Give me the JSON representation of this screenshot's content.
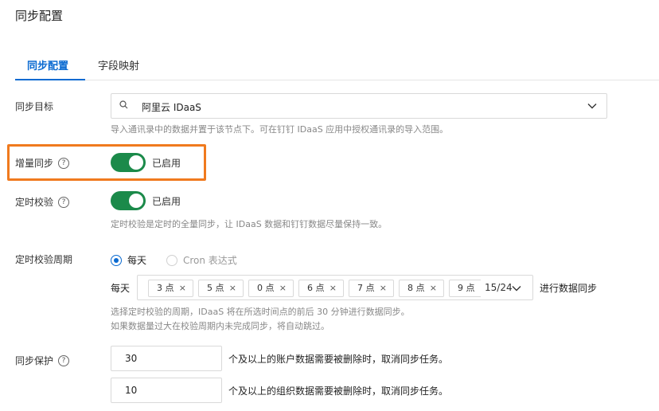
{
  "page_title": "同步配置",
  "tabs": [
    {
      "label": "同步配置",
      "active": true
    },
    {
      "label": "字段映射",
      "active": false
    }
  ],
  "sync_target": {
    "label": "同步目标",
    "value": "阿里云 IDaaS",
    "icon": "search-icon",
    "hint": "导入通讯录中的数据并置于该节点下。可在钉钉 IDaaS 应用中授权通讯录的导入范围。"
  },
  "incremental_sync": {
    "label": "增量同步",
    "help": "?",
    "enabled": true,
    "status": "已启用"
  },
  "scheduled_check": {
    "label": "定时校验",
    "help": "?",
    "enabled": true,
    "status": "已启用",
    "hint": "定时校验是定时的全量同步，让 IDaaS 数据和钉钉数据尽量保持一致。"
  },
  "check_period": {
    "label": "定时校验周期",
    "options": [
      {
        "label": "每天",
        "checked": true
      },
      {
        "label": "Cron 表达式",
        "checked": false
      }
    ],
    "every_label": "每天",
    "tags": [
      "3 点",
      "5 点",
      "0 点",
      "6 点",
      "7 点",
      "8 点",
      "9 点"
    ],
    "tag_close": "×",
    "selected_count": "15/24",
    "after_text": "进行数据同步",
    "hint_line1": "选择定时校验的周期，IDaaS 将在所选时间点的前后 30 分钟进行数据同步。",
    "hint_line2": "如果数据量过大在校验周期内未完成同步，将自动跳过。"
  },
  "sync_protection": {
    "label": "同步保护",
    "help": "?",
    "account_threshold": "30",
    "account_text": "个及以上的账户数据需要被删除时，取消同步任务。",
    "org_threshold": "10",
    "org_text": "个及以上的组织数据需要被删除时，取消同步任务。"
  },
  "colors": {
    "accent": "#0a6ad1",
    "switch_on": "#1b8a4a",
    "highlight": "#f07a1e"
  }
}
